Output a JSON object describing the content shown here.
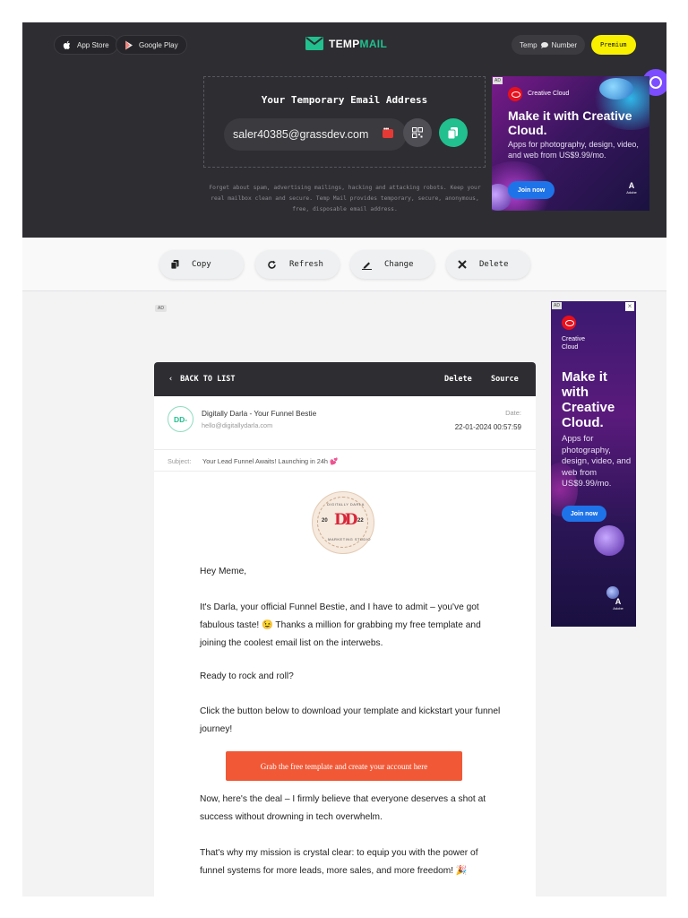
{
  "header": {
    "app_store_label": "App Store",
    "google_play_label": "Google Play",
    "logo_text_1": "TEMP",
    "logo_text_2": "MAIL",
    "temp_number_label_1": "Temp",
    "temp_number_label_2": "Number",
    "premium_label": "Premium",
    "email_title": "Your Temporary Email Address",
    "email_address": "saler40385@grassdev.com",
    "description": "Forget about spam, advertising mailings, hacking and attacking robots. Keep your real mailbox clean and secure. Temp Mail provides temporary, secure, anonymous, free, disposable email address."
  },
  "ad_top": {
    "tag": "AD",
    "brand": "Creative Cloud",
    "headline": "Make it with Creative Cloud.",
    "subtext": "Apps for photography, design, video, and web from US$9.99/mo.",
    "cta": "Join now",
    "adobe": "Adobe"
  },
  "actions": {
    "copy": "Copy",
    "refresh": "Refresh",
    "change": "Change",
    "delete": "Delete"
  },
  "content_ad_tag": "AD",
  "message": {
    "back_label": "BACK TO LIST",
    "delete_label": "Delete",
    "source_label": "Source",
    "avatar_initials": "DD-",
    "sender_name": "Digitally Darla - Your Funnel Bestie",
    "sender_email": "hello@digitallydarla.com",
    "date_label": "Date:",
    "date_value": "22-01-2024 00:57:59",
    "subject_label": "Subject:",
    "subject_value": "Your Lead Funnel Awaits! Launching in 24h 💕",
    "logo": {
      "top_text": "DIGITALLY DARLA",
      "bottom_text": "MARKETING STUDIO",
      "year_left": "20",
      "year_right": "22",
      "monogram": "DD"
    },
    "paragraphs": [
      "Hey Meme,",
      "It's Darla, your official Funnel Bestie, and I have to admit – you've got fabulous taste! 😉 Thanks a million for grabbing my free template and joining the coolest email list on the interwebs.",
      "Ready to rock and roll?",
      "Click the button below to download your template and kickstart your funnel journey!",
      "Now, here's the deal – I firmly believe that everyone deserves a shot at success without drowning in tech overwhelm.",
      "That's why my mission is crystal clear: to equip you with the power of funnel systems for more leads, more sales, and more freedom! 🎉"
    ],
    "cta_label": "Grab the free template and create your account here"
  },
  "ad_side": {
    "tag": "AD",
    "close": "×",
    "brand": "Creative Cloud",
    "headline": "Make it with Creative Cloud.",
    "subtext": "Apps for photography, design, video, and web from US$9.99/mo.",
    "cta": "Join now",
    "adobe": "Adobe"
  }
}
